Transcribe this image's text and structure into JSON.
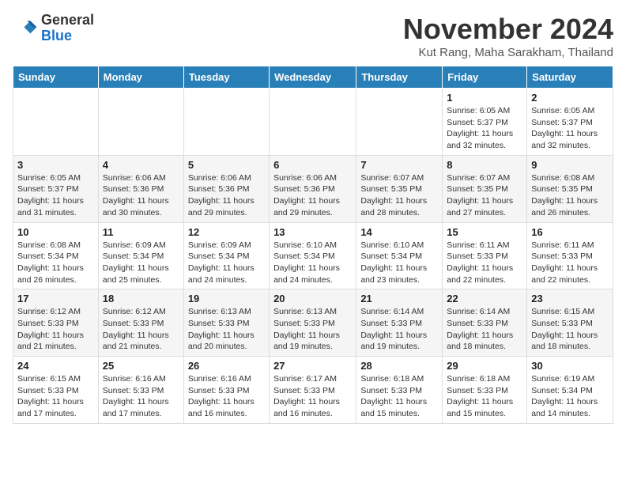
{
  "header": {
    "logo_general": "General",
    "logo_blue": "Blue",
    "month_title": "November 2024",
    "location": "Kut Rang, Maha Sarakham, Thailand"
  },
  "weekdays": [
    "Sunday",
    "Monday",
    "Tuesday",
    "Wednesday",
    "Thursday",
    "Friday",
    "Saturday"
  ],
  "weeks": [
    [
      {
        "day": "",
        "info": ""
      },
      {
        "day": "",
        "info": ""
      },
      {
        "day": "",
        "info": ""
      },
      {
        "day": "",
        "info": ""
      },
      {
        "day": "",
        "info": ""
      },
      {
        "day": "1",
        "info": "Sunrise: 6:05 AM\nSunset: 5:37 PM\nDaylight: 11 hours and 32 minutes."
      },
      {
        "day": "2",
        "info": "Sunrise: 6:05 AM\nSunset: 5:37 PM\nDaylight: 11 hours and 32 minutes."
      }
    ],
    [
      {
        "day": "3",
        "info": "Sunrise: 6:05 AM\nSunset: 5:37 PM\nDaylight: 11 hours and 31 minutes."
      },
      {
        "day": "4",
        "info": "Sunrise: 6:06 AM\nSunset: 5:36 PM\nDaylight: 11 hours and 30 minutes."
      },
      {
        "day": "5",
        "info": "Sunrise: 6:06 AM\nSunset: 5:36 PM\nDaylight: 11 hours and 29 minutes."
      },
      {
        "day": "6",
        "info": "Sunrise: 6:06 AM\nSunset: 5:36 PM\nDaylight: 11 hours and 29 minutes."
      },
      {
        "day": "7",
        "info": "Sunrise: 6:07 AM\nSunset: 5:35 PM\nDaylight: 11 hours and 28 minutes."
      },
      {
        "day": "8",
        "info": "Sunrise: 6:07 AM\nSunset: 5:35 PM\nDaylight: 11 hours and 27 minutes."
      },
      {
        "day": "9",
        "info": "Sunrise: 6:08 AM\nSunset: 5:35 PM\nDaylight: 11 hours and 26 minutes."
      }
    ],
    [
      {
        "day": "10",
        "info": "Sunrise: 6:08 AM\nSunset: 5:34 PM\nDaylight: 11 hours and 26 minutes."
      },
      {
        "day": "11",
        "info": "Sunrise: 6:09 AM\nSunset: 5:34 PM\nDaylight: 11 hours and 25 minutes."
      },
      {
        "day": "12",
        "info": "Sunrise: 6:09 AM\nSunset: 5:34 PM\nDaylight: 11 hours and 24 minutes."
      },
      {
        "day": "13",
        "info": "Sunrise: 6:10 AM\nSunset: 5:34 PM\nDaylight: 11 hours and 24 minutes."
      },
      {
        "day": "14",
        "info": "Sunrise: 6:10 AM\nSunset: 5:34 PM\nDaylight: 11 hours and 23 minutes."
      },
      {
        "day": "15",
        "info": "Sunrise: 6:11 AM\nSunset: 5:33 PM\nDaylight: 11 hours and 22 minutes."
      },
      {
        "day": "16",
        "info": "Sunrise: 6:11 AM\nSunset: 5:33 PM\nDaylight: 11 hours and 22 minutes."
      }
    ],
    [
      {
        "day": "17",
        "info": "Sunrise: 6:12 AM\nSunset: 5:33 PM\nDaylight: 11 hours and 21 minutes."
      },
      {
        "day": "18",
        "info": "Sunrise: 6:12 AM\nSunset: 5:33 PM\nDaylight: 11 hours and 21 minutes."
      },
      {
        "day": "19",
        "info": "Sunrise: 6:13 AM\nSunset: 5:33 PM\nDaylight: 11 hours and 20 minutes."
      },
      {
        "day": "20",
        "info": "Sunrise: 6:13 AM\nSunset: 5:33 PM\nDaylight: 11 hours and 19 minutes."
      },
      {
        "day": "21",
        "info": "Sunrise: 6:14 AM\nSunset: 5:33 PM\nDaylight: 11 hours and 19 minutes."
      },
      {
        "day": "22",
        "info": "Sunrise: 6:14 AM\nSunset: 5:33 PM\nDaylight: 11 hours and 18 minutes."
      },
      {
        "day": "23",
        "info": "Sunrise: 6:15 AM\nSunset: 5:33 PM\nDaylight: 11 hours and 18 minutes."
      }
    ],
    [
      {
        "day": "24",
        "info": "Sunrise: 6:15 AM\nSunset: 5:33 PM\nDaylight: 11 hours and 17 minutes."
      },
      {
        "day": "25",
        "info": "Sunrise: 6:16 AM\nSunset: 5:33 PM\nDaylight: 11 hours and 17 minutes."
      },
      {
        "day": "26",
        "info": "Sunrise: 6:16 AM\nSunset: 5:33 PM\nDaylight: 11 hours and 16 minutes."
      },
      {
        "day": "27",
        "info": "Sunrise: 6:17 AM\nSunset: 5:33 PM\nDaylight: 11 hours and 16 minutes."
      },
      {
        "day": "28",
        "info": "Sunrise: 6:18 AM\nSunset: 5:33 PM\nDaylight: 11 hours and 15 minutes."
      },
      {
        "day": "29",
        "info": "Sunrise: 6:18 AM\nSunset: 5:33 PM\nDaylight: 11 hours and 15 minutes."
      },
      {
        "day": "30",
        "info": "Sunrise: 6:19 AM\nSunset: 5:34 PM\nDaylight: 11 hours and 14 minutes."
      }
    ]
  ]
}
